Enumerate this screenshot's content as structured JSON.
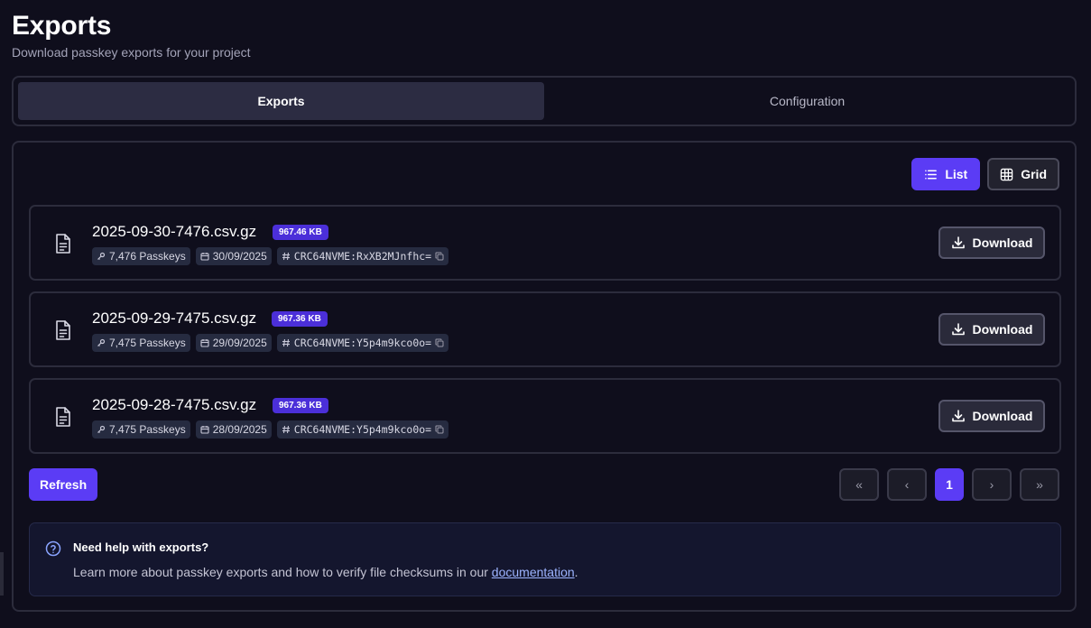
{
  "page": {
    "title": "Exports",
    "subtitle": "Download passkey exports for your project"
  },
  "tabs": [
    {
      "label": "Exports",
      "active": true
    },
    {
      "label": "Configuration",
      "active": false
    }
  ],
  "view_toggle": {
    "list_label": "List",
    "grid_label": "Grid",
    "selected": "List"
  },
  "exports": [
    {
      "file_name": "2025-09-30-7476.csv.gz",
      "size": "967.46 KB",
      "passkeys": "7,476 Passkeys",
      "date": "30/09/2025",
      "checksum": "CRC64NVME:RxXB2MJnfhc=",
      "download_label": "Download"
    },
    {
      "file_name": "2025-09-29-7475.csv.gz",
      "size": "967.36 KB",
      "passkeys": "7,475 Passkeys",
      "date": "29/09/2025",
      "checksum": "CRC64NVME:Y5p4m9kco0o=",
      "download_label": "Download"
    },
    {
      "file_name": "2025-09-28-7475.csv.gz",
      "size": "967.36 KB",
      "passkeys": "7,475 Passkeys",
      "date": "28/09/2025",
      "checksum": "CRC64NVME:Y5p4m9kco0o=",
      "download_label": "Download"
    }
  ],
  "actions": {
    "refresh_label": "Refresh"
  },
  "pagination": {
    "first": "«",
    "prev": "‹",
    "current_page": "1",
    "next": "›",
    "last": "»"
  },
  "help": {
    "title": "Need help with exports?",
    "text_before": "Learn more about passkey exports and how to verify file checksums in our ",
    "link_text": "documentation",
    "text_after": "."
  },
  "colors": {
    "background": "#0f0e1c",
    "accent": "#5b3cf5",
    "link": "#9db4ff"
  },
  "icons": {
    "file": "file-text-icon",
    "passkey": "key-icon",
    "date": "calendar-icon",
    "checksum": "hash-icon",
    "copy": "copy-icon",
    "download": "download-icon",
    "list": "list-icon",
    "grid": "grid-icon",
    "help": "help-circle-icon"
  }
}
